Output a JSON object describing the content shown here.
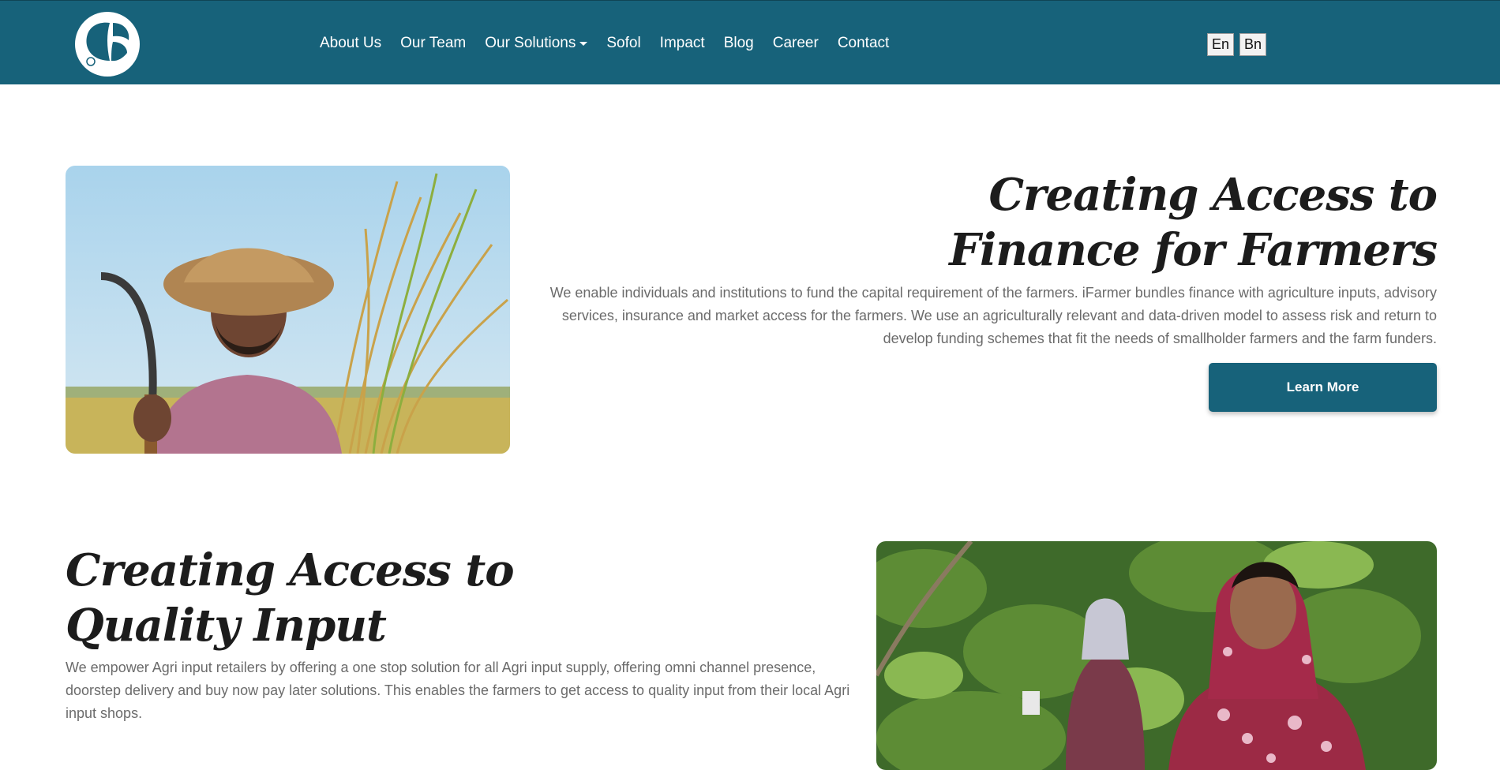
{
  "header": {
    "logo": {
      "icon": "leaf-logo-icon"
    },
    "nav": {
      "about": "About Us",
      "team": "Our Team",
      "solutions": "Our Solutions",
      "sofol": "Sofol",
      "impact": "Impact",
      "blog": "Blog",
      "career": "Career",
      "contact": "Contact"
    },
    "lang": {
      "en": "En",
      "bn": "Bn"
    }
  },
  "finance": {
    "title": "Creating Access to Finance for Farmers",
    "text": "We enable individuals and institutions to fund the capital requirement of the farmers. iFarmer bundles finance with agriculture inputs, advisory services, insurance and market access for the farmers. We use an agriculturally relevant and data-driven model to assess risk and return to develop funding schemes that fit the needs of smallholder farmers and the farm funders.",
    "button": "Learn More"
  },
  "input": {
    "title": "Creating Access to Quality Input",
    "text": "We empower Agri input retailers by offering a one stop solution for all Agri input supply, offering omni channel presence, doorstep delivery and buy now pay later solutions. This enables the farmers to get access to quality input from their local Agri input shops."
  },
  "colors": {
    "brand": "#17627a",
    "heading": "#1c1c1c",
    "body_text": "#6b6b6b"
  }
}
